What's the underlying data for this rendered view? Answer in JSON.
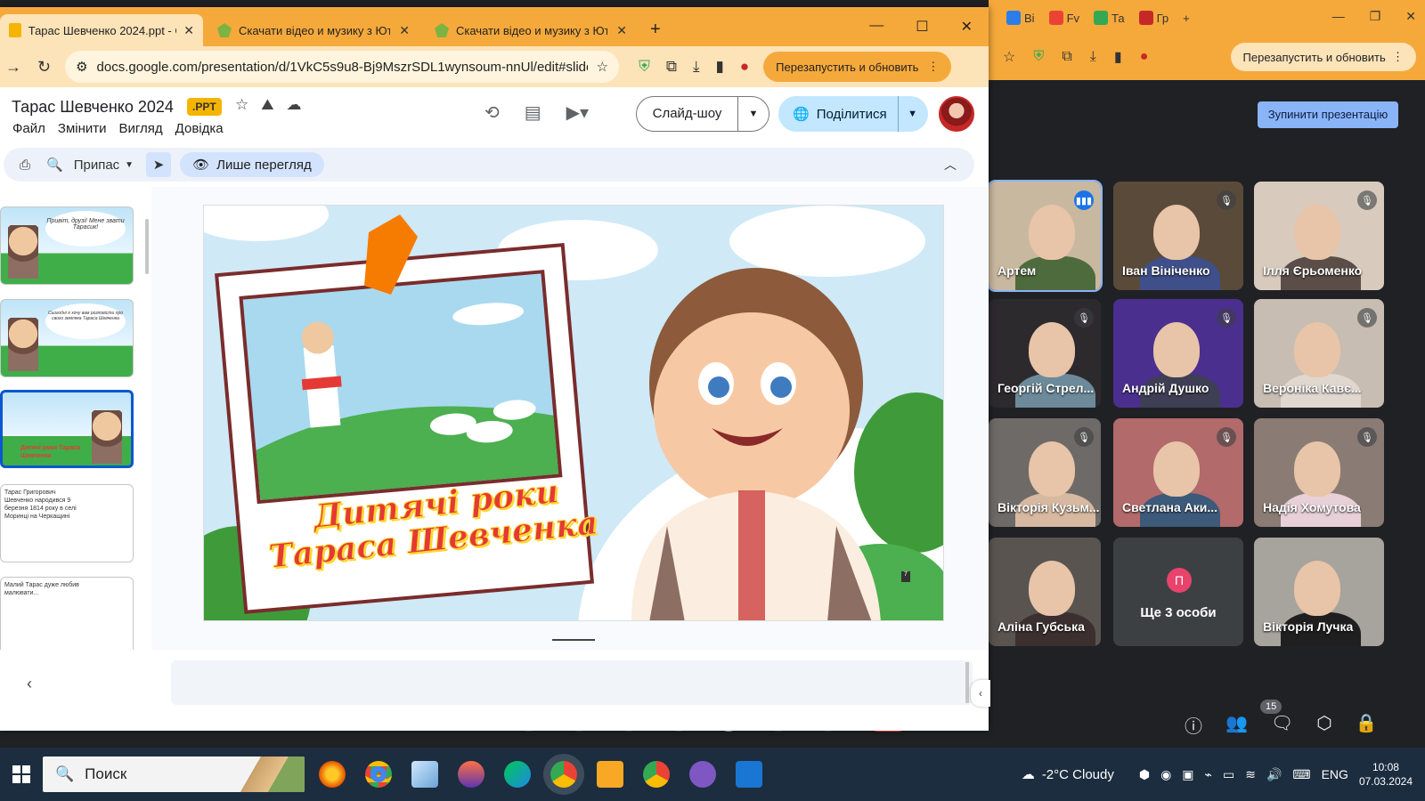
{
  "slides_window": {
    "tabs": [
      {
        "label": "Тарас Шевченко 2024.ppt - Go",
        "active": true
      },
      {
        "label": "Скачати відео и музику з Юту",
        "active": false
      },
      {
        "label": "Скачати відео и музику з Юту",
        "active": false
      }
    ],
    "url": "docs.google.com/presentation/d/1VkC5s9u8-Bj9MszrSDL1wynsoum-nnUl/edit#slide...",
    "restart_label": "Перезапустить и обновить",
    "doc_title": "Тарас Шевченко 2024",
    "file_badge": ".PPT",
    "menus": [
      "Файл",
      "Змінити",
      "Вигляд",
      "Довідка"
    ],
    "slideshow_label": "Слайд-шоу",
    "share_label": "Поділитися",
    "zoom_label": "Припас",
    "view_only_label": "Лише перегляд",
    "thumbnails": [
      {
        "text": "Привіт, друзі! Мене звати Тарасик!"
      },
      {
        "text": "Сьогодні я хочу вам розповісти про свого земляка Тараса Шевченка"
      },
      {
        "text": "Дитячі роки Тараса Шевченка"
      },
      {
        "text": "Тарас Григорович Шевченко народився 9 березня 1814 року в селі Моринці на Черкащині"
      },
      {
        "text": "Малий Тарас дуже любив малювати..."
      }
    ],
    "slide": {
      "title_line1": "Дитячі роки",
      "title_line2": "Тараса Шевченка",
      "page_number": "7"
    }
  },
  "meet": {
    "tabs": [
      "Ві",
      "Fv",
      "Та",
      "Гр"
    ],
    "restart_label": "Перезапустить и обновить",
    "stop_presentation": "Зупинити презентацію",
    "participants": [
      {
        "name": "Артем",
        "muted": false,
        "speaking": true,
        "bg": "#c9b8a0",
        "body": "#4e6b3d"
      },
      {
        "name": "Іван Вініченко",
        "muted": true,
        "speaking": false,
        "bg": "#5a4a3a",
        "body": "#3f4f8a"
      },
      {
        "name": "Ілля Єрьоменко",
        "muted": true,
        "speaking": false,
        "bg": "#d8cbbd",
        "body": "#5b4e48"
      },
      {
        "name": "Георгій Стрел...",
        "muted": true,
        "speaking": false,
        "bg": "#2d2a2e",
        "body": "#6d8a9a"
      },
      {
        "name": "Андрій Душко",
        "muted": true,
        "speaking": false,
        "bg": "#4b2f8f",
        "body": "#3e3e55"
      },
      {
        "name": "Вероніка Кавє...",
        "muted": true,
        "speaking": false,
        "bg": "#c7bdb2",
        "body": "#e0d7cf"
      },
      {
        "name": "Вікторія Кузьм...",
        "muted": true,
        "speaking": false,
        "bg": "#6e6a67",
        "body": "#d6b9a0"
      },
      {
        "name": "Светлана Аки...",
        "muted": true,
        "speaking": false,
        "bg": "#b26a6a",
        "body": "#3d5a7a"
      },
      {
        "name": "Надія Хомутова",
        "muted": true,
        "speaking": false,
        "bg": "#8a7c74",
        "body": "#e8d0d8"
      },
      {
        "name": "Аліна Губська",
        "muted": false,
        "speaking": false,
        "bg": "#5a5450",
        "body": "#3b2f2f"
      },
      {
        "name": "Ще 3 особи",
        "muted": false,
        "speaking": false,
        "bg": "#3c4043",
        "body": "transparent"
      },
      {
        "name": "Вікторія Лучка",
        "muted": false,
        "speaking": false,
        "bg": "#a7a39d",
        "body": "#1f1f1f"
      }
    ],
    "more_initial": "П",
    "people_count": "15"
  },
  "taskbar": {
    "search_placeholder": "Поиск",
    "weather": "-2°C  Cloudy",
    "lang": "ENG",
    "time": "10:08",
    "date": "07.03.2024"
  }
}
